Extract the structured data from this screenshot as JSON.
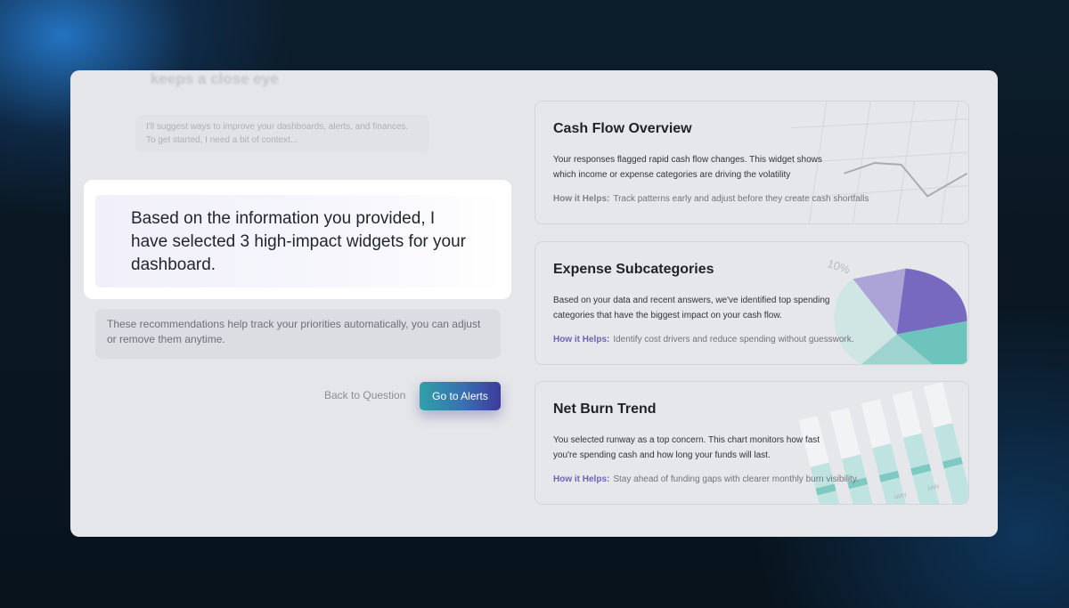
{
  "assistant": {
    "faded_heading": "keeps a close eye",
    "intro_line_1": "I'll suggest ways to improve your dashboards, alerts, and finances.",
    "intro_line_2": "To get started, I need a bit of context...",
    "highlight_message": "Based on the information you provided, I have selected 3 high-impact widgets for your dashboard.",
    "recommendation_note": "These recommendations help track your priorities automatically, you can adjust or remove them anytime.",
    "back_label": "Back to Question",
    "primary_label": "Go to Alerts"
  },
  "widgets": [
    {
      "title": "Cash Flow Overview",
      "description": "Your responses flagged rapid cash flow changes. This widget shows which income or expense categories are driving the volatility",
      "help_label": "How it Helps:",
      "help_text": "Track patterns early and adjust before they create cash shortfalls"
    },
    {
      "title": "Expense Subcategories",
      "description": "Based on your data and recent answers, we've identified top spending categories that have the biggest impact on your cash flow.",
      "help_label": "How it Helps:",
      "help_text": "Identify cost drivers and reduce spending without guesswork.",
      "art_label": "10%"
    },
    {
      "title": "Net Burn Trend",
      "description": "You selected runway as a top concern. This chart monitors how fast you're spending cash and how long your funds will last.",
      "help_label": "How it Helps:",
      "help_text": "Stay ahead of funding gaps with clearer monthly burn visibility.",
      "art_labels": [
        "MAY",
        "MIN"
      ]
    }
  ],
  "colors": {
    "accent_purple": "#6c63b8",
    "button_gradient_start": "#2fa0a8",
    "button_gradient_end": "#3c3a9a",
    "pie_purple": "#7b6cc4",
    "pie_teal": "#6cc4bd"
  }
}
